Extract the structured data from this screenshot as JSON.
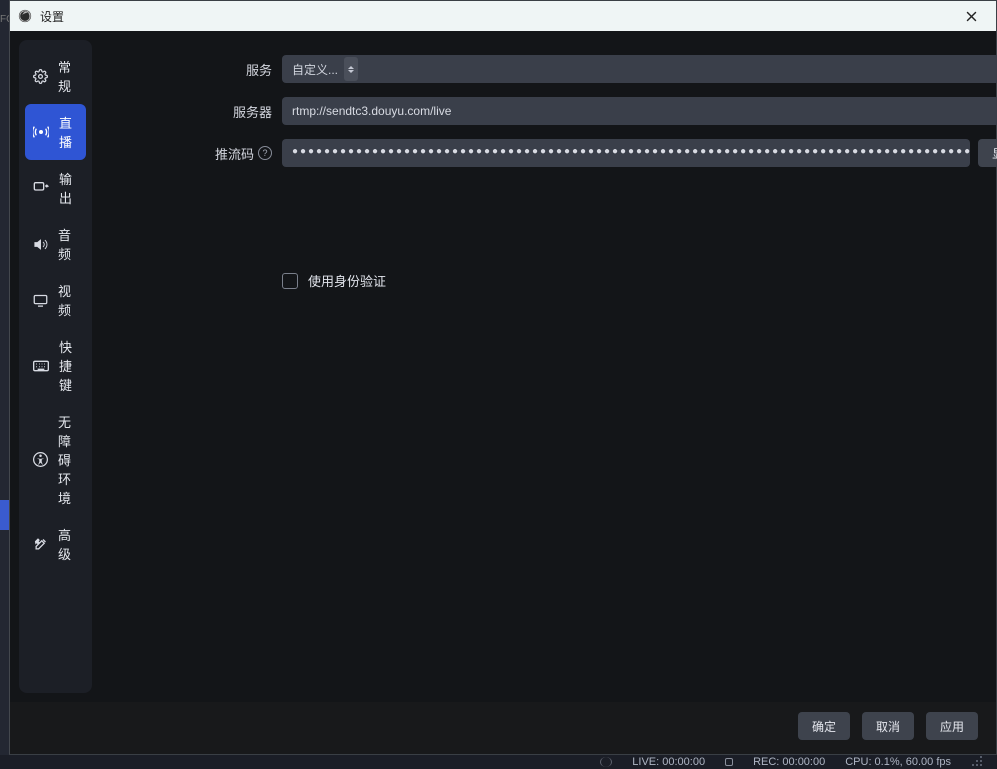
{
  "titlebar": {
    "title": "设置"
  },
  "sidebar": {
    "items": [
      {
        "label": "常规"
      },
      {
        "label": "直播"
      },
      {
        "label": "输出"
      },
      {
        "label": "音频"
      },
      {
        "label": "视频"
      },
      {
        "label": "快捷键"
      },
      {
        "label": "无障碍环境"
      },
      {
        "label": "高级"
      }
    ]
  },
  "form": {
    "service_label": "服务",
    "service_value": "自定义...",
    "server_label": "服务器",
    "server_value": "rtmp://sendtc3.douyu.com/live",
    "key_label": "推流码",
    "key_mask": "●●●●●●●●●●●●●●●●●●●●●●●●●●●●●●●●●●●●●●●●●●●●●●●●●●●●●●●●●●●●●●●●●●●●●●●●●●●●●●●●●●●●●",
    "show_btn": "显示",
    "auth_label": "使用身份验证"
  },
  "buttons": {
    "ok": "确定",
    "cancel": "取消",
    "apply": "应用"
  },
  "statusbar": {
    "live": "LIVE: 00:00:00",
    "rec": "REC: 00:00:00",
    "cpu": "CPU: 0.1%, 60.00 fps"
  },
  "bg": {
    "fc": "FC"
  }
}
